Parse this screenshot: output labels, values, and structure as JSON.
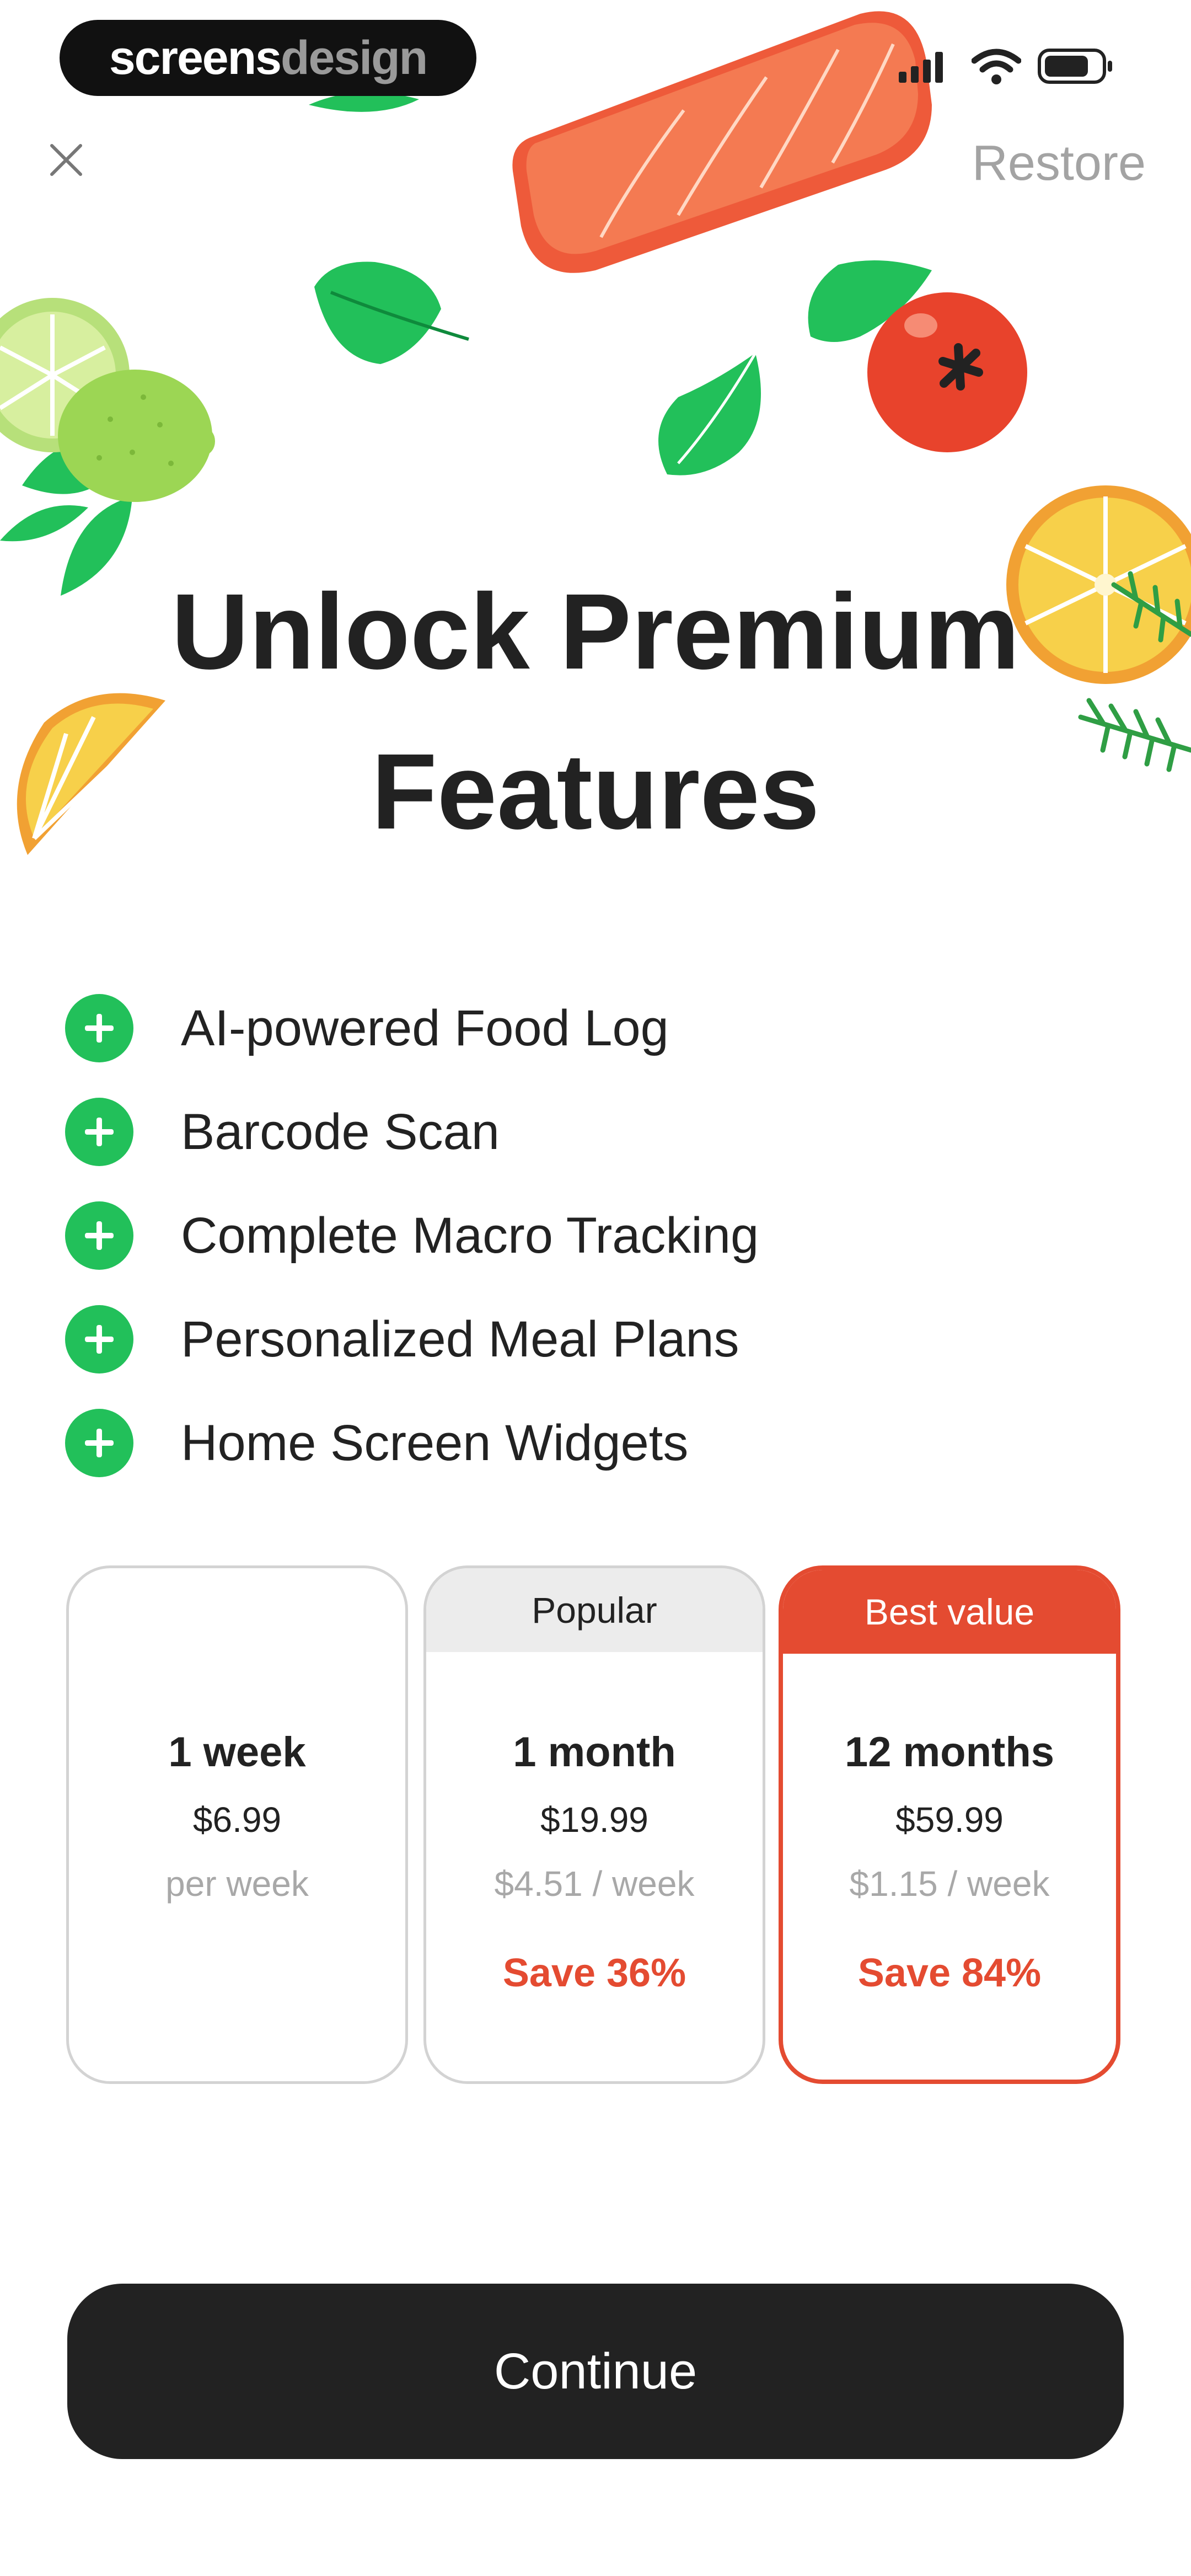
{
  "status_bar": {
    "brand_part1": "screens",
    "brand_part2": "design",
    "icons": [
      "signal-icon",
      "wifi-icon",
      "battery-icon"
    ]
  },
  "header": {
    "close_icon": "close-icon",
    "restore_label": "Restore"
  },
  "title": {
    "line1": "Unlock Premium",
    "line2": "Features"
  },
  "features": [
    {
      "label": "AI-powered Food Log"
    },
    {
      "label": "Barcode Scan"
    },
    {
      "label": "Complete Macro Tracking"
    },
    {
      "label": "Personalized Meal Plans"
    },
    {
      "label": "Home Screen Widgets"
    }
  ],
  "plans": [
    {
      "badge": "",
      "duration": "1 week",
      "price": "$6.99",
      "per": "per week",
      "save": ""
    },
    {
      "badge": "Popular",
      "duration": "1 month",
      "price": "$19.99",
      "per": "$4.51 / week",
      "save": "Save 36%"
    },
    {
      "badge": "Best value",
      "duration": "12 months",
      "price": "$59.99",
      "per": "$1.15 / week",
      "save": "Save 84%",
      "selected": true
    }
  ],
  "cta": {
    "label": "Continue"
  },
  "colors": {
    "accent": "#e44b31",
    "check_green": "#22c05a",
    "button_dark": "#222222",
    "muted_text": "#a8a8a8"
  }
}
